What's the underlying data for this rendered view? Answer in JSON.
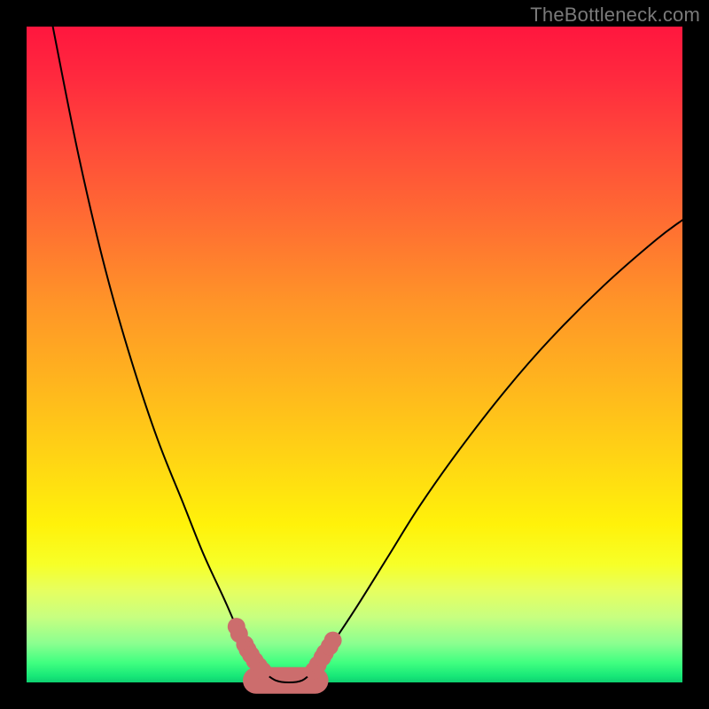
{
  "watermark": "TheBottleneck.com",
  "colors": {
    "background": "#000000",
    "gradient_top": "#ff163e",
    "gradient_bottom": "#0ed070",
    "curve": "#000000",
    "marker": "#cc6d6d"
  },
  "chart_data": {
    "type": "line",
    "title": "",
    "xlabel": "",
    "ylabel": "",
    "xlim": [
      0,
      100
    ],
    "ylim": [
      0,
      100
    ],
    "series": [
      {
        "name": "left-curve",
        "x": [
          4,
          8,
          12,
          16,
          20,
          24,
          27,
          30,
          32,
          33.5,
          35,
          36.2
        ],
        "y": [
          100,
          80,
          63,
          49,
          37,
          27,
          19.5,
          13,
          8.5,
          5.5,
          3,
          1.5
        ]
      },
      {
        "name": "vertex-flat",
        "x": [
          36.2,
          38,
          40,
          42,
          43.5
        ],
        "y": [
          1.5,
          0.3,
          0,
          0.3,
          1.5
        ]
      },
      {
        "name": "right-curve",
        "x": [
          43.5,
          46,
          50,
          55,
          60,
          66,
          73,
          80,
          88,
          96,
          100
        ],
        "y": [
          1.5,
          5,
          11,
          19,
          27,
          35.5,
          44.5,
          52.5,
          60.5,
          67.5,
          70.5
        ]
      }
    ],
    "markers": [
      {
        "x": 32.0,
        "y": 8.5
      },
      {
        "x": 32.4,
        "y": 7.4
      },
      {
        "x": 33.3,
        "y": 5.8
      },
      {
        "x": 33.7,
        "y": 5.0
      },
      {
        "x": 34.2,
        "y": 4.2
      },
      {
        "x": 34.8,
        "y": 3.3
      },
      {
        "x": 35.4,
        "y": 2.5
      },
      {
        "x": 36.0,
        "y": 1.8
      },
      {
        "x": 43.8,
        "y": 1.8
      },
      {
        "x": 44.4,
        "y": 2.7
      },
      {
        "x": 45.1,
        "y": 3.8
      },
      {
        "x": 45.5,
        "y": 4.5
      },
      {
        "x": 46.2,
        "y": 5.5
      },
      {
        "x": 46.7,
        "y": 6.4
      }
    ],
    "flat_segment": {
      "x_start": 35.0,
      "x_end": 44.0,
      "y": 0.3
    }
  }
}
